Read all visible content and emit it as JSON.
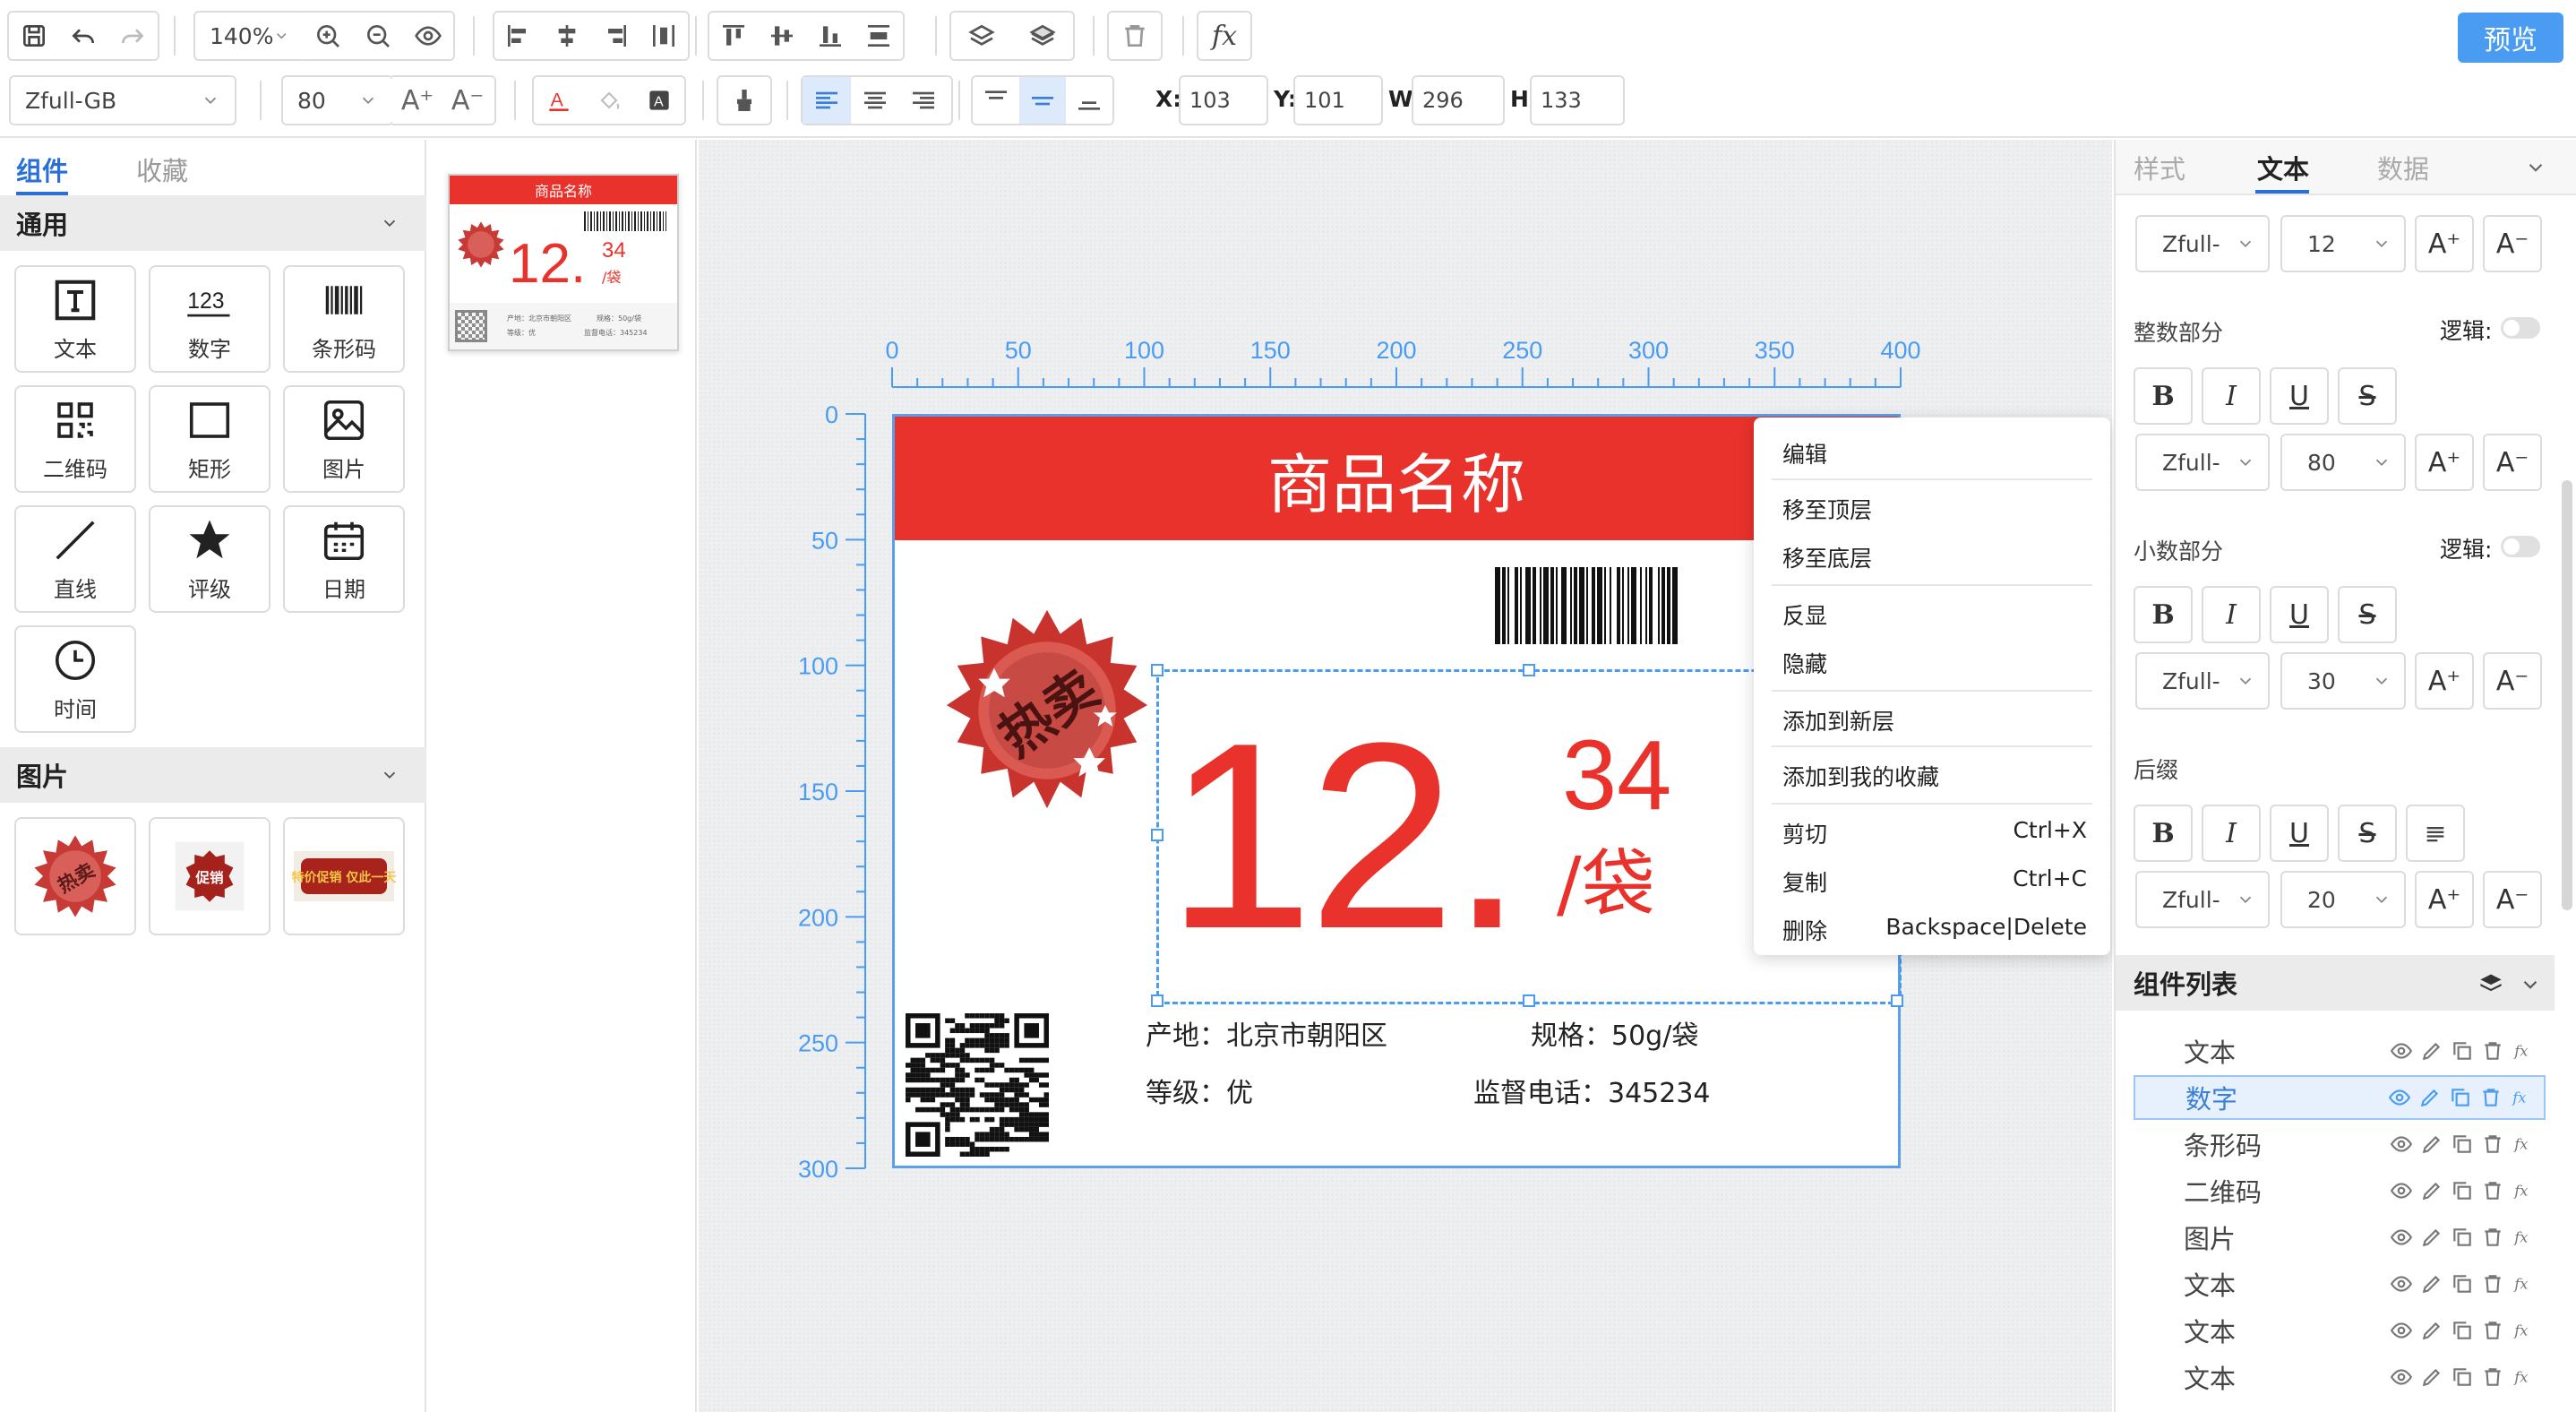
{
  "toolbar": {
    "zoom": "140%",
    "preview_label": "预览",
    "fx_label": "fx"
  },
  "format_bar": {
    "font_family": "Zfull-GB",
    "font_size": "80",
    "x_label": "X:",
    "x_value": "103",
    "y_label": "Y:",
    "y_value": "101",
    "w_label": "W:",
    "w_value": "296",
    "h_label": "H:",
    "h_value": "133"
  },
  "left_panel": {
    "tabs": [
      "组件",
      "收藏"
    ],
    "active_tab": "组件",
    "section_general": "通用",
    "components": [
      {
        "label": "文本",
        "icon": "text-icon"
      },
      {
        "label": "数字",
        "icon": "number-icon"
      },
      {
        "label": "条形码",
        "icon": "barcode-icon"
      },
      {
        "label": "二维码",
        "icon": "qrcode-icon"
      },
      {
        "label": "矩形",
        "icon": "rectangle-icon"
      },
      {
        "label": "图片",
        "icon": "image-icon"
      },
      {
        "label": "直线",
        "icon": "line-icon"
      },
      {
        "label": "评级",
        "icon": "star-icon"
      },
      {
        "label": "日期",
        "icon": "calendar-icon"
      },
      {
        "label": "时间",
        "icon": "clock-icon"
      }
    ],
    "section_images": "图片",
    "image_items": [
      {
        "text": "热卖"
      },
      {
        "text": "促销"
      },
      {
        "text": "特价促销 仅此一天"
      }
    ]
  },
  "thumbnail": {
    "title": "商品名称",
    "price_int": "12.",
    "price_dec": "34",
    "unit": "/袋",
    "origin_line": "产地：北京市朝阳区",
    "spec_line": "规格：50g/袋",
    "grade_line": "等级：优",
    "phone_line": "监督电话：345234"
  },
  "ruler": {
    "x_ticks": [
      "0",
      "50",
      "100",
      "150",
      "200",
      "250",
      "300",
      "350",
      "400"
    ],
    "y_ticks": [
      "0",
      "50",
      "100",
      "150",
      "200",
      "250",
      "300"
    ]
  },
  "label": {
    "title": "商品名称",
    "badge_text": "热卖",
    "price_int": "12.",
    "price_dec": "34",
    "unit": "/袋",
    "origin_label": "产地：",
    "origin_value": "北京市朝阳区",
    "spec_label": "规格：",
    "spec_value": "50g/袋",
    "grade_label": "等级：",
    "grade_value": "优",
    "phone_label": "监督电话：",
    "phone_value": "345234"
  },
  "context_menu": {
    "edit": "编辑",
    "bring_to_front": "移至顶层",
    "send_to_back": "移至底层",
    "invert": "反显",
    "hide": "隐藏",
    "add_to_layer": "添加到新层",
    "add_to_favorites": "添加到我的收藏",
    "cut": "剪切",
    "cut_shortcut": "Ctrl+X",
    "copy": "复制",
    "copy_shortcut": "Ctrl+C",
    "delete": "删除",
    "delete_shortcut": "Backspace|Delete"
  },
  "right_panel": {
    "tabs": [
      "样式",
      "文本",
      "数据"
    ],
    "active_tab": "文本",
    "top_font": "Zfull-",
    "top_size": "12",
    "integer_part": "整数部分",
    "integer_font": "Zfull-",
    "integer_size": "80",
    "decimal_part": "小数部分",
    "decimal_font": "Zfull-",
    "decimal_size": "30",
    "logic_label": "逻辑:",
    "suffix": "后缀",
    "suffix_font": "Zfull-",
    "suffix_size": "20",
    "bold": "B",
    "italic": "I",
    "underline": "U",
    "strike": "S",
    "component_list_title": "组件列表",
    "component_list": [
      {
        "name": "文本",
        "selected": false
      },
      {
        "name": "数字",
        "selected": true
      },
      {
        "name": "条形码",
        "selected": false
      },
      {
        "name": "二维码",
        "selected": false
      },
      {
        "name": "图片",
        "selected": false
      },
      {
        "name": "文本",
        "selected": false
      },
      {
        "name": "文本",
        "selected": false
      },
      {
        "name": "文本",
        "selected": false
      }
    ]
  },
  "colors": {
    "accent_blue": "#4a9cf3",
    "label_red": "#e8322b",
    "selected_row": "#e6f1fd"
  }
}
